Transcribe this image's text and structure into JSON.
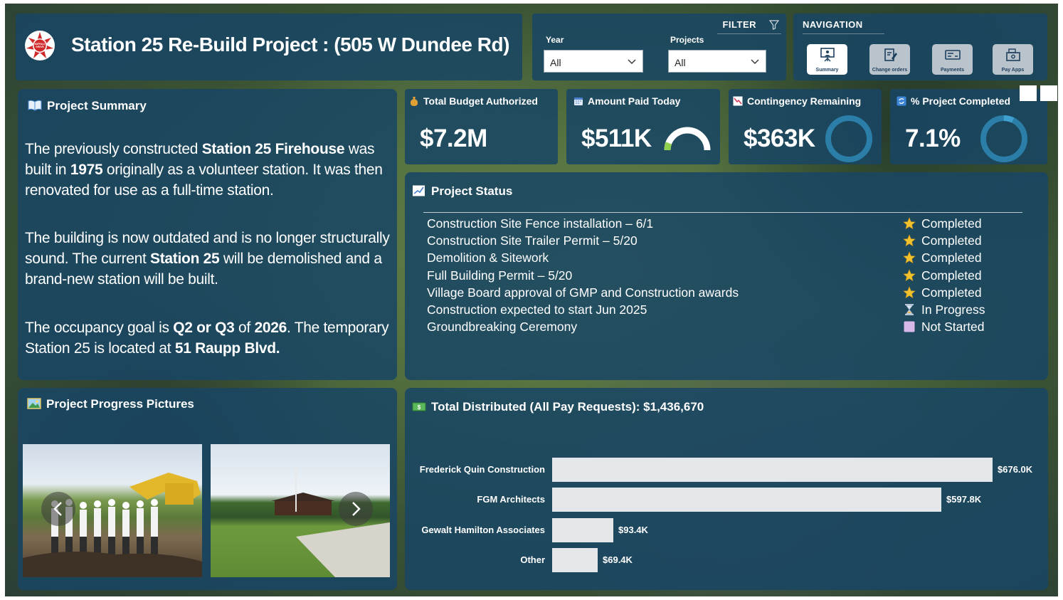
{
  "header": {
    "title": "Station 25 Re-Build Project : (505 W Dundee Rd)",
    "logo_text": [
      "FIRE",
      "BUFFALO GROVE",
      "DEPT"
    ]
  },
  "filter": {
    "heading": "FILTER",
    "year_label": "Year",
    "year_value": "All",
    "projects_label": "Projects",
    "projects_value": "All"
  },
  "navigation": {
    "heading": "NAVIGATION",
    "buttons": [
      {
        "label": "Summary",
        "icon": "presentation-icon",
        "active": true
      },
      {
        "label": "Change orders",
        "icon": "clipboard-edit-icon",
        "active": false
      },
      {
        "label": "Payments",
        "icon": "check-payment-icon",
        "active": false
      },
      {
        "label": "Pay Apps",
        "icon": "cash-register-icon",
        "active": false
      }
    ]
  },
  "summary": {
    "title": "Project Summary",
    "p1": [
      "The previously constructed ",
      "Station 25 Firehouse",
      " was built in ",
      "1975",
      " originally as a volunteer station. It was then renovated for use as a full-time station."
    ],
    "p2": [
      "The building is now outdated and is no longer structurally sound. The current ",
      "Station 25",
      " will be demolished and a brand-new station will be built."
    ],
    "p3": [
      "The occupancy goal is ",
      "Q2 or Q3",
      " of ",
      "2026",
      ". The temporary Station 25 is located at ",
      "51 Raupp Blvd."
    ]
  },
  "kpis": [
    {
      "title": "Total Budget Authorized",
      "value": "$7.2M",
      "icon": "money-bag-icon"
    },
    {
      "title": "Amount Paid Today",
      "value": "$511K",
      "icon": "calendar-icon",
      "gauge_fraction": 0.07
    },
    {
      "title": "Contingency Remaining",
      "value": "$363K",
      "icon": "chart-down-icon",
      "ring_fraction": 0.99
    },
    {
      "title": "% Project Completed",
      "value": "7.1%",
      "icon": "refresh-icon",
      "ring_fraction": 0.071
    }
  ],
  "status": {
    "title": "Project Status",
    "rows": [
      {
        "task": "Construction Site Fence installation – 6/1",
        "state": "Completed",
        "icon": "star-icon"
      },
      {
        "task": "Construction Site Trailer Permit – 5/20",
        "state": "Completed",
        "icon": "star-icon"
      },
      {
        "task": "Demolition & Sitework",
        "state": "Completed",
        "icon": "star-icon"
      },
      {
        "task": "Full Building Permit – 5/20",
        "state": "Completed",
        "icon": "star-icon"
      },
      {
        "task": "Village Board approval of GMP and Construction awards",
        "state": "Completed",
        "icon": "star-icon"
      },
      {
        "task": "Construction expected to start Jun 2025",
        "state": "In Progress",
        "icon": "hourglass-icon"
      },
      {
        "task": "Groundbreaking Ceremony",
        "state": "Not Started",
        "icon": "square-icon"
      }
    ]
  },
  "pictures": {
    "title": "Project Progress Pictures"
  },
  "distributed": {
    "title": "Total Distributed (All Pay Requests): $1,436,670"
  },
  "chart_data": {
    "type": "bar",
    "orientation": "horizontal",
    "title": "Total Distributed (All Pay Requests): $1,436,670",
    "categories": [
      "Frederick Quin Construction",
      "FGM Architects",
      "Gewalt Hamilton Associates",
      "Other"
    ],
    "values": [
      676.0,
      597.8,
      93.4,
      69.4
    ],
    "value_labels": [
      "$676.0K",
      "$597.8K",
      "$93.4K",
      "$69.4K"
    ],
    "unit": "K USD",
    "bar_color": "#e3e7ea"
  },
  "colors": {
    "panel": "#19466a",
    "accent_ring": "#2a7ea8",
    "star": "#f2c12e"
  }
}
